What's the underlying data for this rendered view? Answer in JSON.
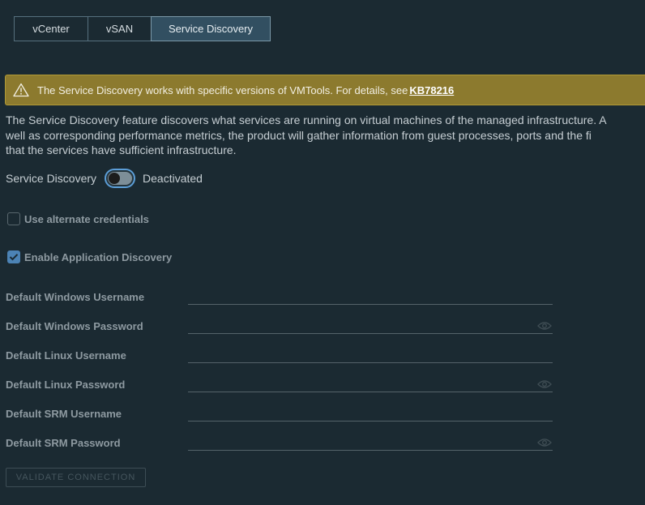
{
  "tabs": [
    {
      "label": "vCenter"
    },
    {
      "label": "vSAN"
    },
    {
      "label": "Service Discovery"
    }
  ],
  "alert": {
    "message": "The Service Discovery works with specific versions of VMTools. For details, see",
    "link": "KB78216",
    "icon": "warning-icon"
  },
  "description": [
    "The Service Discovery feature discovers what services are running on virtual machines of the managed infrastructure. A",
    "well as corresponding performance metrics, the product will gather information from guest processes, ports and the fi",
    "that the services have sufficient infrastructure."
  ],
  "service_discovery": {
    "label": "Service Discovery",
    "state_label": "Deactivated",
    "enabled": false
  },
  "checkboxes": {
    "alt_creds": {
      "label": "Use alternate credentials",
      "checked": false
    },
    "app_discovery": {
      "label": "Enable Application Discovery",
      "checked": true
    }
  },
  "fields": {
    "win_user": {
      "label": "Default Windows Username",
      "value": ""
    },
    "win_pass": {
      "label": "Default Windows Password",
      "value": ""
    },
    "linux_user": {
      "label": "Default Linux Username",
      "value": ""
    },
    "linux_pass": {
      "label": "Default Linux Password",
      "value": ""
    },
    "srm_user": {
      "label": "Default SRM Username",
      "value": ""
    },
    "srm_pass": {
      "label": "Default SRM Password",
      "value": ""
    }
  },
  "validate_button": "VALIDATE CONNECTION",
  "colors": {
    "background": "#1b2a32",
    "alert_bg": "#8c7a2e",
    "accent": "#5c9ed8",
    "selected_tab": "#324f61"
  }
}
